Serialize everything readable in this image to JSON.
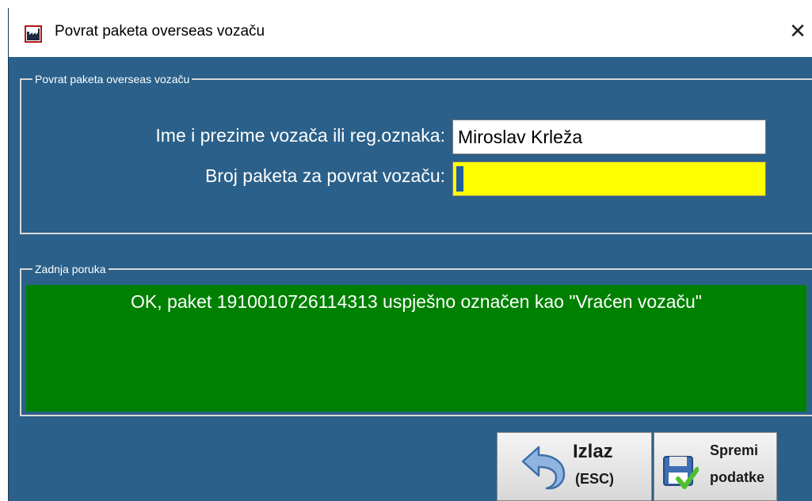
{
  "window": {
    "title": "Povrat paketa overseas vozaču",
    "close_glyph": "✕",
    "icon": "factory-icon"
  },
  "group_main": {
    "legend": "Povrat paketa overseas vozaču",
    "driver_label": "Ime i prezime vozača ili reg.oznaka:",
    "driver_value": "Miroslav Krleža",
    "package_label": "Broj paketa za povrat vozaču:",
    "package_value": ""
  },
  "group_message": {
    "legend": "Zadnja poruka",
    "text": "OK, paket 1910010726114313 uspješno označen kao \"Vraćen vozaču\""
  },
  "buttons": {
    "exit_line1": "Izlaz",
    "exit_line2": "(ESC)",
    "exit_icon": "back-arrow-icon",
    "save_line1": "Spremi",
    "save_line2": "podatke",
    "save_icon": "floppy-check-icon"
  },
  "colors": {
    "window_bg": "#2a6089",
    "message_bg": "#008000",
    "active_input_bg": "#ffff00"
  }
}
